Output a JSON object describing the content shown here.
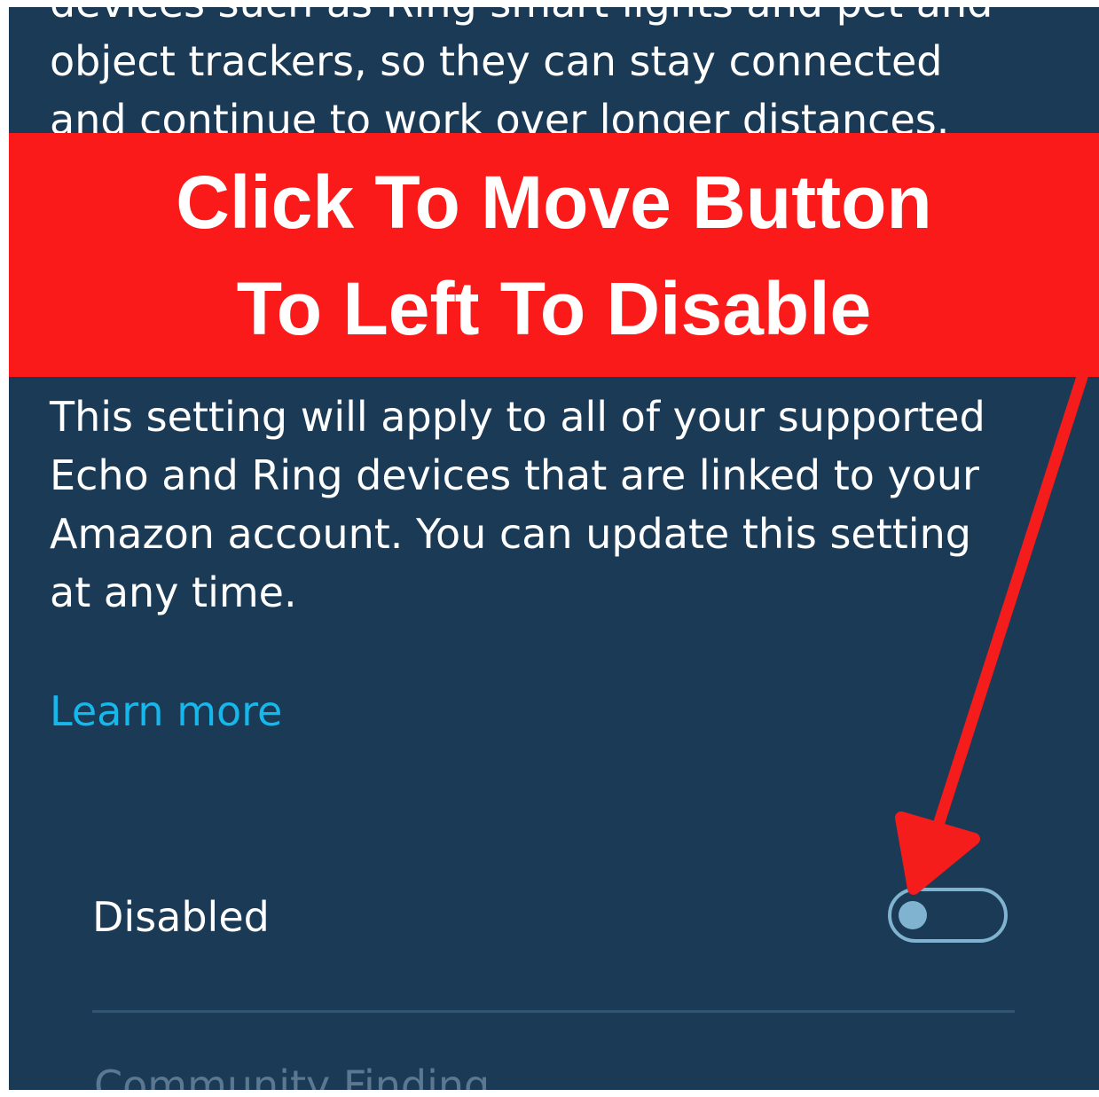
{
  "intro_text": {
    "lines": [
      "devices such as Ring smart lights and pet and",
      "object trackers, so they can stay connected",
      "and continue to work over longer distances."
    ]
  },
  "annotation": {
    "banner_lines": [
      "Click To Move Button",
      "To Left To Disable"
    ],
    "banner_color": "#fb1a1a",
    "arrow_color": "#f51c1c"
  },
  "description": {
    "lines": [
      "This setting will apply to all of your supported",
      "Echo and Ring devices that are linked to your",
      "Amazon account. You can update this setting",
      "at any time."
    ]
  },
  "learn_more": {
    "label": "Learn more",
    "color": "#16b8ec"
  },
  "toggle_setting": {
    "label": "Disabled",
    "state": "off"
  },
  "next_section": {
    "title": "Community Finding"
  },
  "theme": {
    "background": "#1a3a56",
    "toggle_color": "#7fb3cf"
  }
}
